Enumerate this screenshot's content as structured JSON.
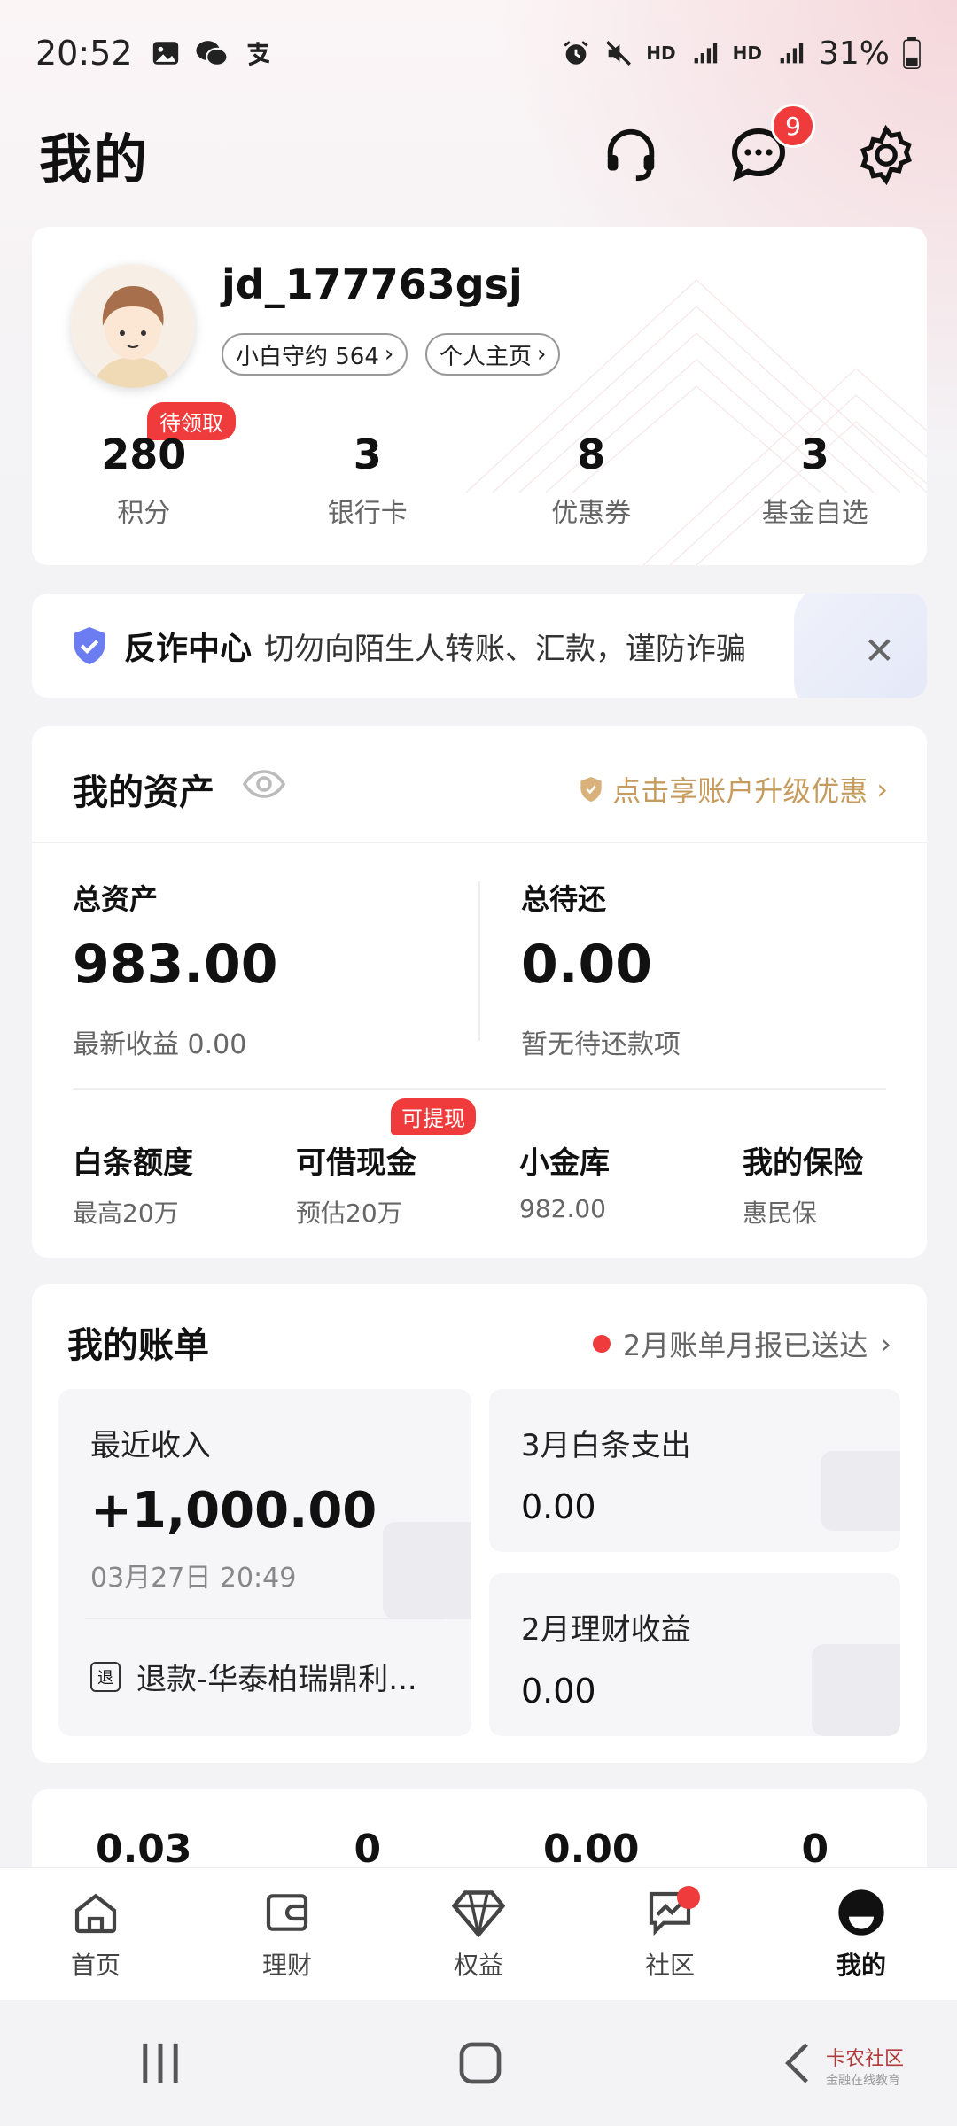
{
  "status_bar": {
    "time": "20:52",
    "battery": "31%"
  },
  "header": {
    "title": "我的",
    "message_badge": "9"
  },
  "profile": {
    "username": "jd_177763gsj",
    "pill_promise": "小白守约 564",
    "pill_homepage": "个人主页",
    "pending_tag": "待领取",
    "stats": [
      {
        "value": "280",
        "label": "积分"
      },
      {
        "value": "3",
        "label": "银行卡"
      },
      {
        "value": "8",
        "label": "优惠券"
      },
      {
        "value": "3",
        "label": "基金自选"
      }
    ]
  },
  "fraud_banner": {
    "title": "反诈中心",
    "text": "切勿向陌生人转账、汇款，谨防诈骗"
  },
  "assets": {
    "title": "我的资产",
    "promo": "点击享账户升级优惠",
    "total_assets_label": "总资产",
    "total_assets_value": "983.00",
    "latest_income": "最新收益 0.00",
    "total_due_label": "总待还",
    "total_due_value": "0.00",
    "no_due": "暂无待还款项",
    "withdraw_tag": "可提现",
    "mini": [
      {
        "title": "白条额度",
        "sub": "最高20万"
      },
      {
        "title": "可借现金",
        "sub": "预估20万"
      },
      {
        "title": "小金库",
        "sub": "982.00"
      },
      {
        "title": "我的保险",
        "sub": "惠民保"
      }
    ]
  },
  "bills": {
    "title": "我的账单",
    "notice": "2月账单月报已送达",
    "recent_income_label": "最近收入",
    "recent_income_value": "+1,000.00",
    "recent_income_time": "03月27日 20:49",
    "refund_icon": "退",
    "refund_text": "退款-华泰柏瑞鼎利...",
    "baitiao_label": "3月白条支出",
    "baitiao_value": "0.00",
    "licai_label": "2月理财收益",
    "licai_value": "0.00"
  },
  "peek_values": [
    "0.03",
    "0",
    "0.00",
    "0"
  ],
  "tabs": [
    {
      "label": "首页",
      "icon": "home-icon"
    },
    {
      "label": "理财",
      "icon": "wallet-icon"
    },
    {
      "label": "权益",
      "icon": "diamond-icon"
    },
    {
      "label": "社区",
      "icon": "chart-chat-icon"
    },
    {
      "label": "我的",
      "icon": "profile-icon"
    }
  ],
  "watermark": {
    "main": "卡农社区",
    "sub": "金融在线教育"
  },
  "colors": {
    "accent_red": "#ef3b3b",
    "gold": "#c59c5e",
    "shield_blue": "#6b7df0"
  }
}
